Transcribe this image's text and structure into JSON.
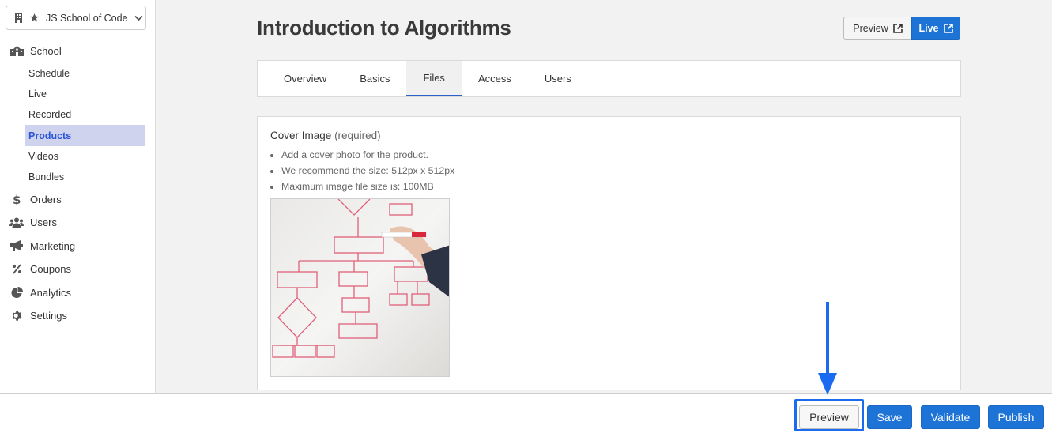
{
  "sidebar": {
    "school_name": "JS School of Code",
    "nav": {
      "school": "School",
      "schedule": "Schedule",
      "live": "Live",
      "recorded": "Recorded",
      "products": "Products",
      "videos": "Videos",
      "bundles": "Bundles",
      "orders": "Orders",
      "users": "Users",
      "marketing": "Marketing",
      "coupons": "Coupons",
      "analytics": "Analytics",
      "settings": "Settings"
    },
    "active_item": "Products"
  },
  "page": {
    "title": "Introduction to Algorithms",
    "preview_label": "Preview",
    "live_label": "Live"
  },
  "tabs": {
    "overview": "Overview",
    "basics": "Basics",
    "files": "Files",
    "access": "Access",
    "users": "Users",
    "active": "Files"
  },
  "cover": {
    "label": "Cover Image",
    "required": "(required)",
    "hints": [
      "Add a cover photo for the product.",
      "We recommend the size: 512px x 512px",
      "Maximum image file size is: 100MB"
    ]
  },
  "bottom_bar": {
    "preview": "Preview",
    "save": "Save",
    "validate": "Validate",
    "publish": "Publish"
  },
  "colors": {
    "accent_blue": "#1e74d6",
    "active_nav_bg": "#cfd3ee",
    "active_nav_text": "#2b55d6",
    "highlight": "#1a6bf0"
  }
}
